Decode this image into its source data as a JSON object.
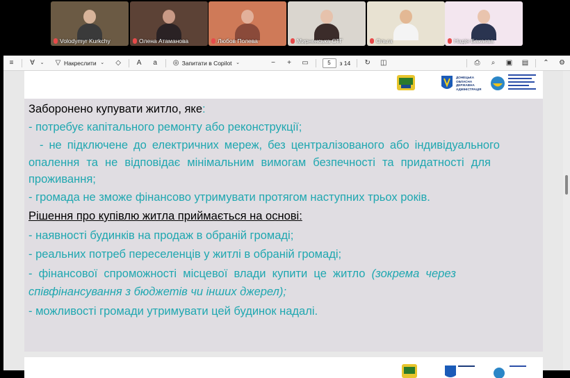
{
  "participants": [
    {
      "name": "Volodymyr Kurkchy",
      "bg": "#6b5a44",
      "skin": "#d8b49a",
      "shirt": "#3a3a3a"
    },
    {
      "name": "Олена Атаманова",
      "bg": "#5c4236",
      "skin": "#c99a86",
      "shirt": "#2a2224"
    },
    {
      "name": "Любов Полева",
      "bg": "#cf7a58",
      "skin": "#e2b09a",
      "shirt": "#8a4a3a"
    },
    {
      "name": "Мирненська СТГ",
      "bg": "#dad6cf",
      "skin": "#e6c2ac",
      "shirt": "#3b2c2a"
    },
    {
      "name": "Ольга",
      "bg": "#e8e2d2",
      "skin": "#e3b894",
      "shirt": "#f4f4f4"
    },
    {
      "name": "Надія Бакаєва",
      "bg": "#f3e6ef",
      "skin": "#e9c4ae",
      "shirt": "#2a3450"
    }
  ],
  "toolbar": {
    "draw_label": "Накреслити",
    "copilot_label": "Запитати в Copilot",
    "page_current": "5",
    "page_total": "з 14"
  },
  "slide": {
    "header_logos": [
      "donetsk-coat-of-arms",
      "ukraine-trident",
      "social-dept-logo"
    ],
    "header_text_1": "ДОНЕЦЬКА ОБЛАСНА ДЕРЖАВНА АДМІНІСТРАЦІЯ",
    "heading_1_black": "Заборонено купувати житло, яке",
    "heading_1_colon": ":",
    "items_1": [
      "- потребує капітального ремонту або реконструкції;",
      "  - не підключене до електричних мереж, без централізованого або індивідуального",
      "опалення та не відповідає мінімальним вимогам безпечності та придатності для",
      "проживання;",
      "- громада не зможе фінансово утримувати протягом наступних трьох років."
    ],
    "heading_2": "Рішення про купівлю житла приймається на основі:",
    "items_2": [
      "- наявності будинків на продаж в обраній громаді;",
      "- реальних потреб переселенців у житлі в обраній громаді;"
    ],
    "item_3_regular": "-  фінансової  спроможності  місцевої  влади  купити  це  житло",
    "item_3_italic": "(зокрема  через",
    "item_3_line2_italic": "співфінансування з бюджетів чи інших джерел);",
    "item_4": "- можливості громади утримувати цей будинок надалі."
  },
  "colors": {
    "accent_teal": "#1fa7b0",
    "slide_bg": "#e0dde2",
    "toolbar_bg": "#f7f7f7"
  }
}
